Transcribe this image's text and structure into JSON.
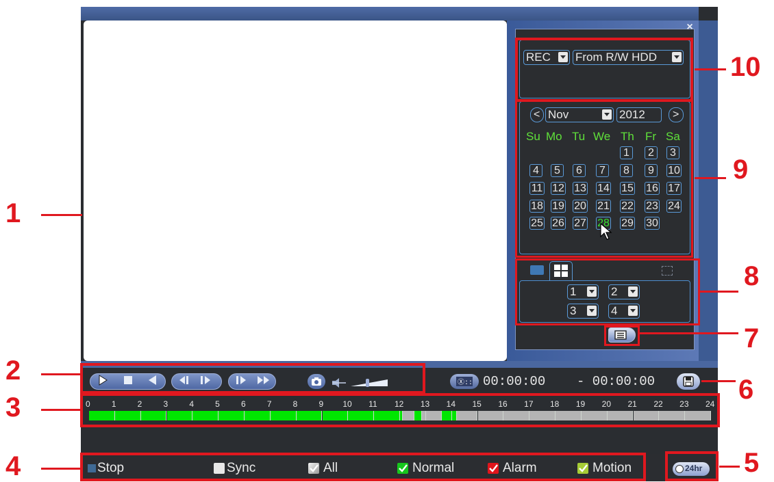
{
  "playback": {
    "rec_type": "REC",
    "source": "From R/W HDD",
    "month": "Nov",
    "year": "2012",
    "prev": "<",
    "next": ">",
    "weekdays": [
      "Su",
      "Mo",
      "Tu",
      "We",
      "Th",
      "Fr",
      "Sa"
    ],
    "days": [
      "1",
      "2",
      "3",
      "4",
      "5",
      "6",
      "7",
      "8",
      "9",
      "10",
      "11",
      "12",
      "13",
      "14",
      "15",
      "16",
      "17",
      "18",
      "19",
      "20",
      "21",
      "22",
      "23",
      "24",
      "25",
      "26",
      "27",
      "28",
      "29",
      "30"
    ],
    "selected_day": "28",
    "channels": [
      "1",
      "2",
      "3",
      "4"
    ],
    "time_start": "00:00:00",
    "time_end": "- 00:00:00",
    "hours": [
      "0",
      "1",
      "2",
      "3",
      "4",
      "5",
      "6",
      "7",
      "8",
      "9",
      "10",
      "11",
      "12",
      "13",
      "14",
      "15",
      "16",
      "17",
      "18",
      "19",
      "20",
      "21",
      "22",
      "23",
      "24"
    ],
    "status": {
      "stop": "Stop",
      "sync": "Sync",
      "all": "All",
      "normal": "Normal",
      "alarm": "Alarm",
      "motion": "Motion",
      "scale": "24hr"
    },
    "callouts": [
      "1",
      "2",
      "3",
      "4",
      "5",
      "6",
      "7",
      "8",
      "9",
      "10"
    ],
    "colors": {
      "record_normal": "#00e600",
      "no_record": "#b4b4b4",
      "highlight": "#e0181f",
      "day_header": "#5fe03a"
    }
  }
}
